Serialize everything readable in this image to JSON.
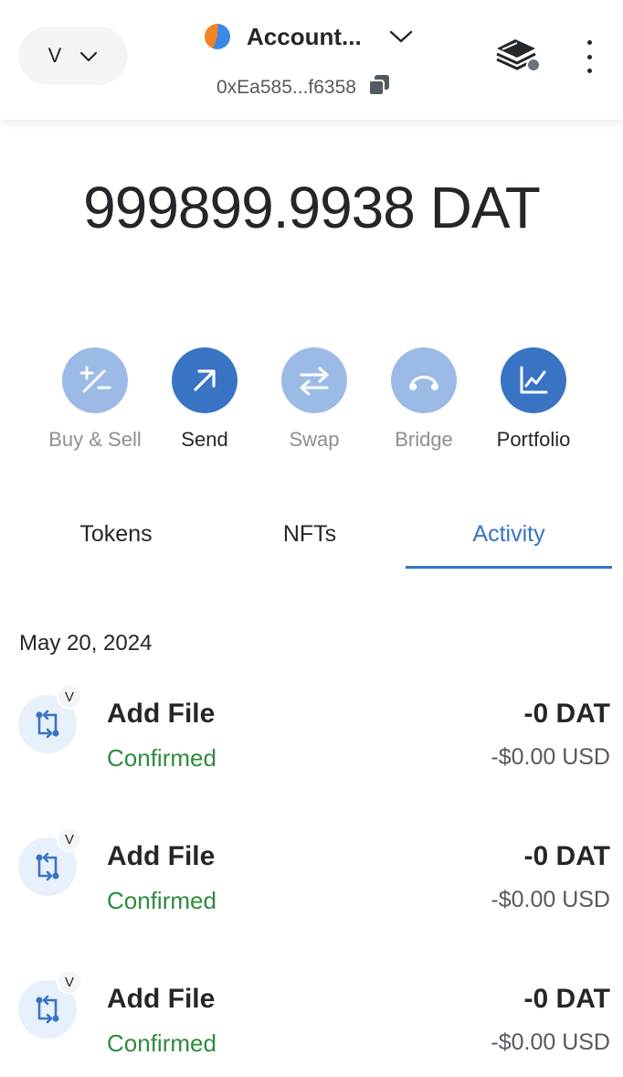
{
  "header": {
    "network_label": "V",
    "account_name": "Account...",
    "address": "0xEa585...f6358"
  },
  "balance": "999899.9938 DAT",
  "actions": [
    {
      "label": "Buy & Sell",
      "icon": "plus-minus-icon",
      "state": "disabled"
    },
    {
      "label": "Send",
      "icon": "arrow-up-right-icon",
      "state": "active"
    },
    {
      "label": "Swap",
      "icon": "swap-arrows-icon",
      "state": "disabled"
    },
    {
      "label": "Bridge",
      "icon": "bridge-icon",
      "state": "disabled"
    },
    {
      "label": "Portfolio",
      "icon": "chart-icon",
      "state": "active"
    }
  ],
  "tabs": [
    {
      "label": "Tokens",
      "active": false
    },
    {
      "label": "NFTs",
      "active": false
    },
    {
      "label": "Activity",
      "active": true
    }
  ],
  "activity": {
    "date": "May 20, 2024",
    "items": [
      {
        "badge": "V",
        "title": "Add File",
        "status": "Confirmed",
        "amount": "-0 DAT",
        "fiat": "-$0.00 USD"
      },
      {
        "badge": "V",
        "title": "Add File",
        "status": "Confirmed",
        "amount": "-0 DAT",
        "fiat": "-$0.00 USD"
      },
      {
        "badge": "V",
        "title": "Add File",
        "status": "Confirmed",
        "amount": "-0 DAT",
        "fiat": "-$0.00 USD"
      }
    ]
  },
  "colors": {
    "accent": "#3873c4",
    "accent_disabled": "#9bbbe6",
    "success": "#2e8b3e"
  }
}
